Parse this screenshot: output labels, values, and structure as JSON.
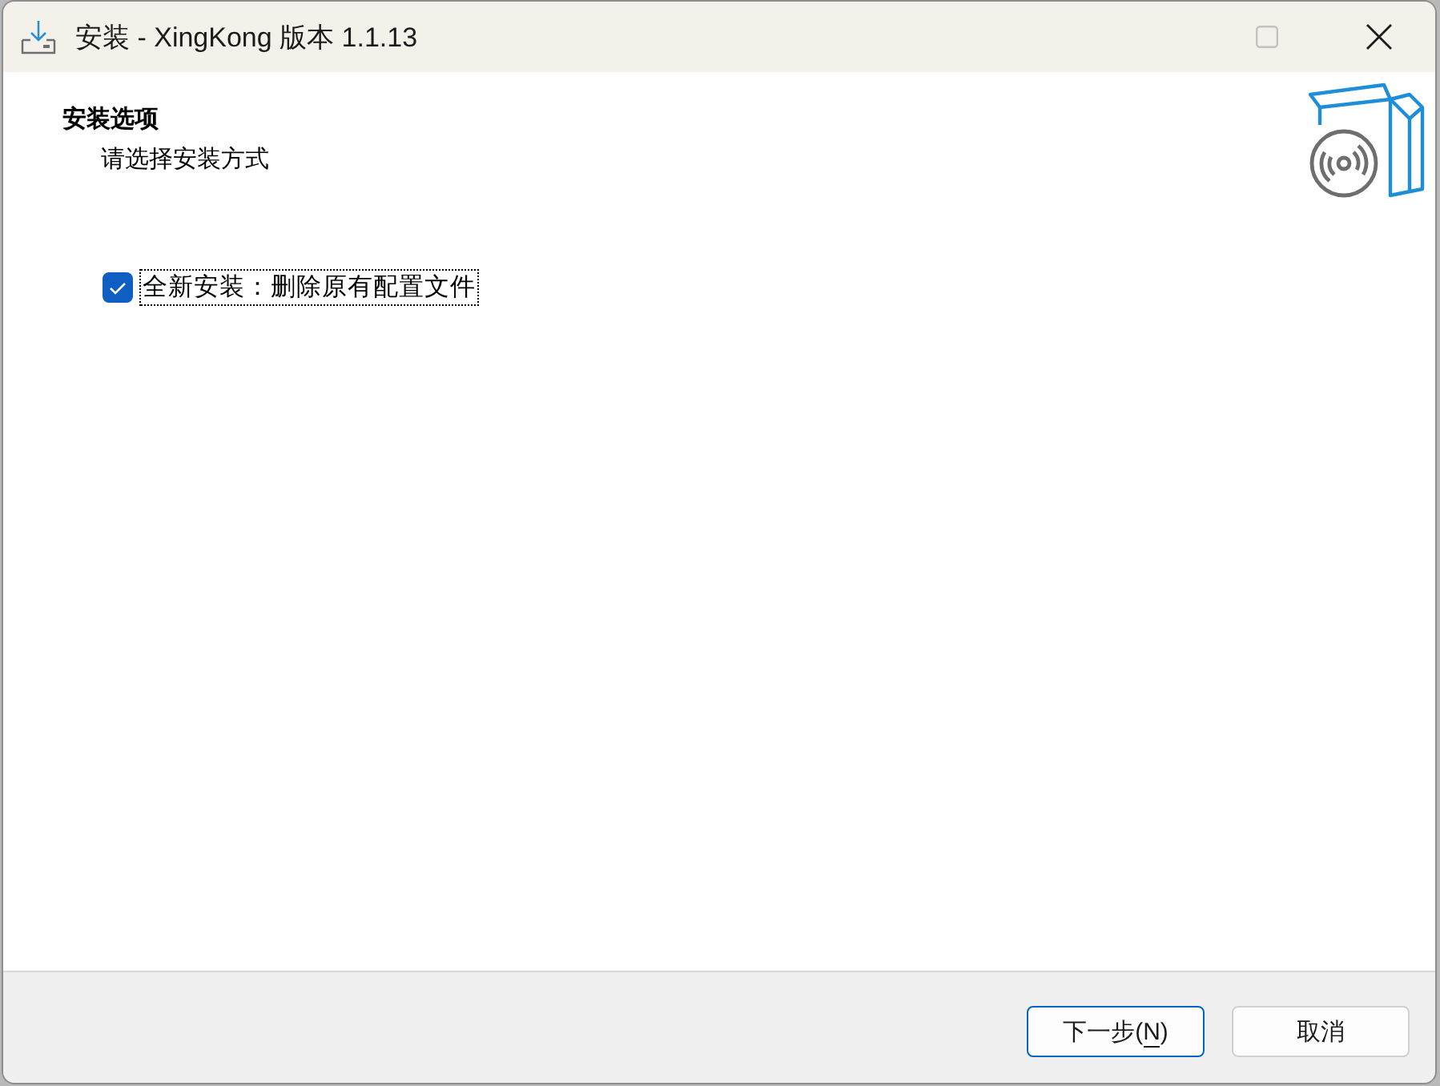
{
  "window": {
    "title": "安装 - XingKong 版本 1.1.13",
    "controls": [
      {
        "kind": "maximize",
        "disabled": true
      },
      {
        "kind": "close",
        "disabled": false
      }
    ]
  },
  "header": {
    "title": "安装选项",
    "subtitle": "请选择安装方式"
  },
  "options": [
    {
      "label": "全新安装：删除原有配置文件",
      "checked": true,
      "focused": true
    }
  ],
  "buttons": [
    {
      "label": [
        {
          "text": "下一步(",
          "underlined": false
        },
        {
          "text": "N",
          "underlined": true
        },
        {
          "text": ")",
          "underlined": false
        }
      ],
      "default": true
    },
    {
      "label": [
        {
          "text": "取消",
          "underlined": false
        }
      ],
      "default": false
    }
  ]
}
